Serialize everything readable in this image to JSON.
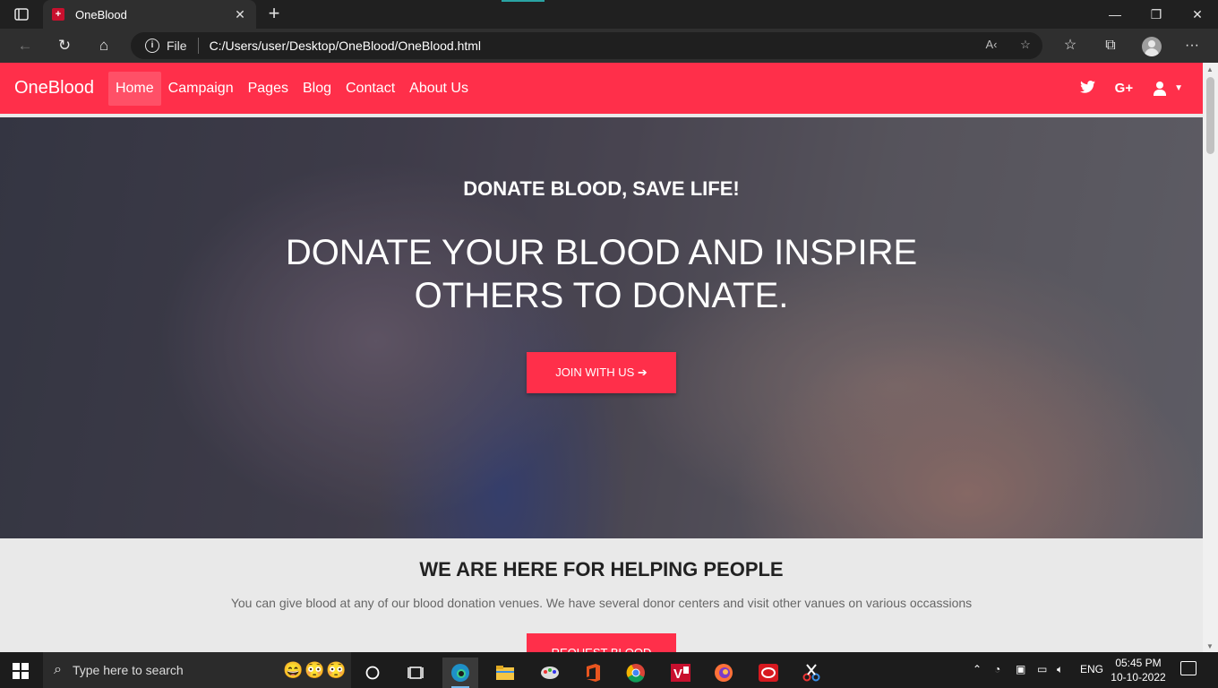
{
  "browser": {
    "tab_title": "OneBlood",
    "address_label": "File",
    "url": "C:/Users/user/Desktop/OneBlood/OneBlood.html"
  },
  "site": {
    "brand": "OneBlood",
    "nav": [
      "Home",
      "Campaign",
      "Pages",
      "Blog",
      "Contact",
      "About Us"
    ],
    "active_nav": "Home",
    "social": [
      "twitter-icon",
      "google-plus-icon"
    ],
    "google_plus_label": "G+",
    "accent_color": "#ff2f4a"
  },
  "hero": {
    "subtitle": "DONATE BLOOD, SAVE LIFE!",
    "title_line1": "DONATE YOUR BLOOD AND INSPIRE",
    "title_line2": "OTHERS TO DONATE.",
    "button": "JOIN WITH US ➔"
  },
  "section": {
    "title": "WE ARE HERE FOR HELPING PEOPLE",
    "text": "You can give blood at any of our blood donation venues. We have several donor centers and visit other vanues on various occassions",
    "button": "REQUEST BLOOD"
  },
  "taskbar": {
    "search_placeholder": "Type here to search",
    "language": "ENG",
    "time": "05:45 PM",
    "date": "10-10-2022"
  }
}
